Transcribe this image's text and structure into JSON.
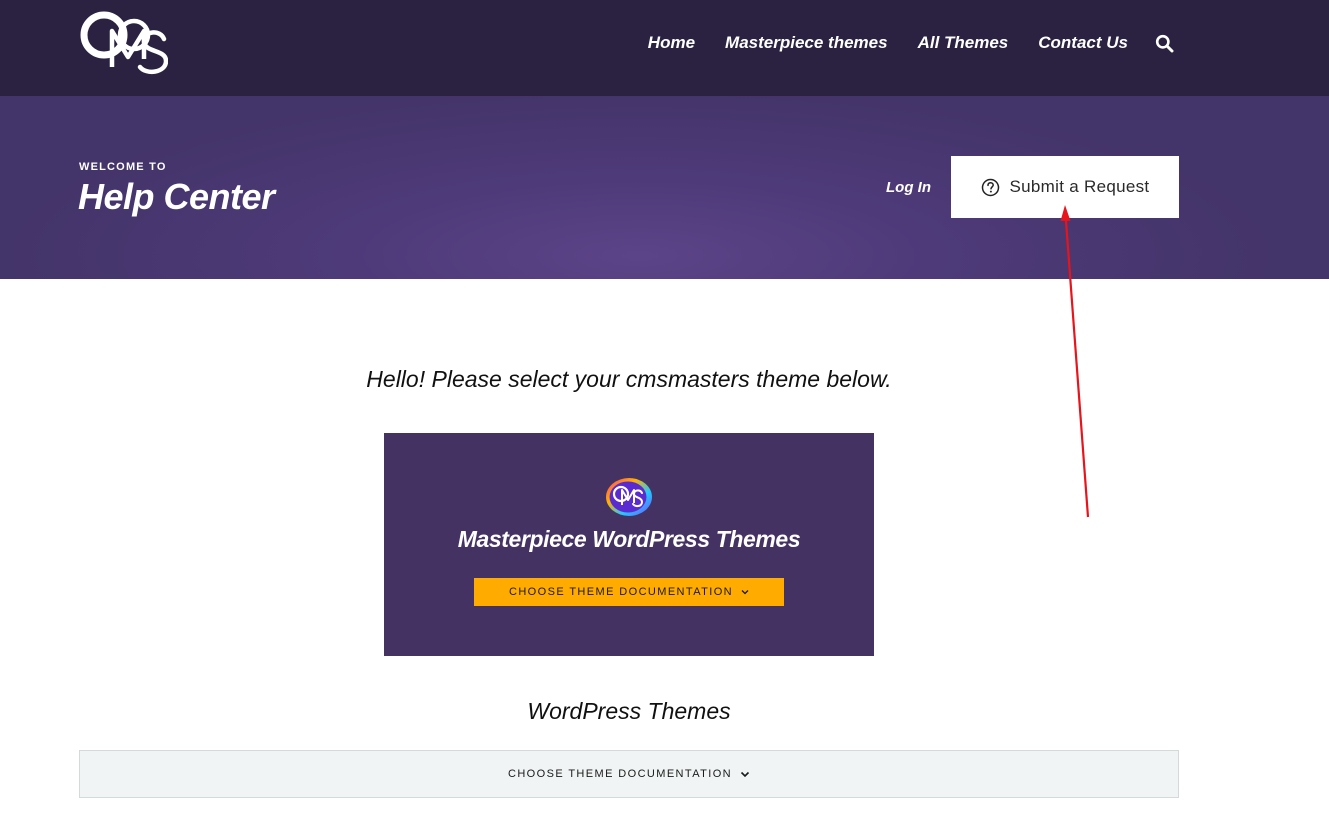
{
  "header": {
    "logo_icon": "cms-logo-icon",
    "nav": [
      {
        "label": "Home"
      },
      {
        "label": "Masterpiece themes"
      },
      {
        "label": "All Themes"
      },
      {
        "label": "Contact Us"
      }
    ],
    "search_icon": "search-icon"
  },
  "hero": {
    "eyebrow": "WELCOME TO",
    "title": "Help Center",
    "login_label": "Log In",
    "submit_label": "Submit a Request",
    "submit_icon": "question-circle-icon"
  },
  "main": {
    "intro": "Hello! Please select your cmsmasters theme below.",
    "card": {
      "logo_icon": "cms-gradient-logo-icon",
      "title": "Masterpiece WordPress Themes",
      "button_label": "CHOOSE THEME DOCUMENTATION"
    },
    "wp_heading": "WordPress Themes",
    "wp_select_label": "CHOOSE THEME DOCUMENTATION"
  },
  "annotation": {
    "arrow_color": "#e8141b"
  },
  "colors": {
    "topbar": "#2a2240",
    "hero": "#4e3a79",
    "card": "#443263",
    "accent_button": "#ffab00",
    "select_background": "#f0f4f4"
  }
}
